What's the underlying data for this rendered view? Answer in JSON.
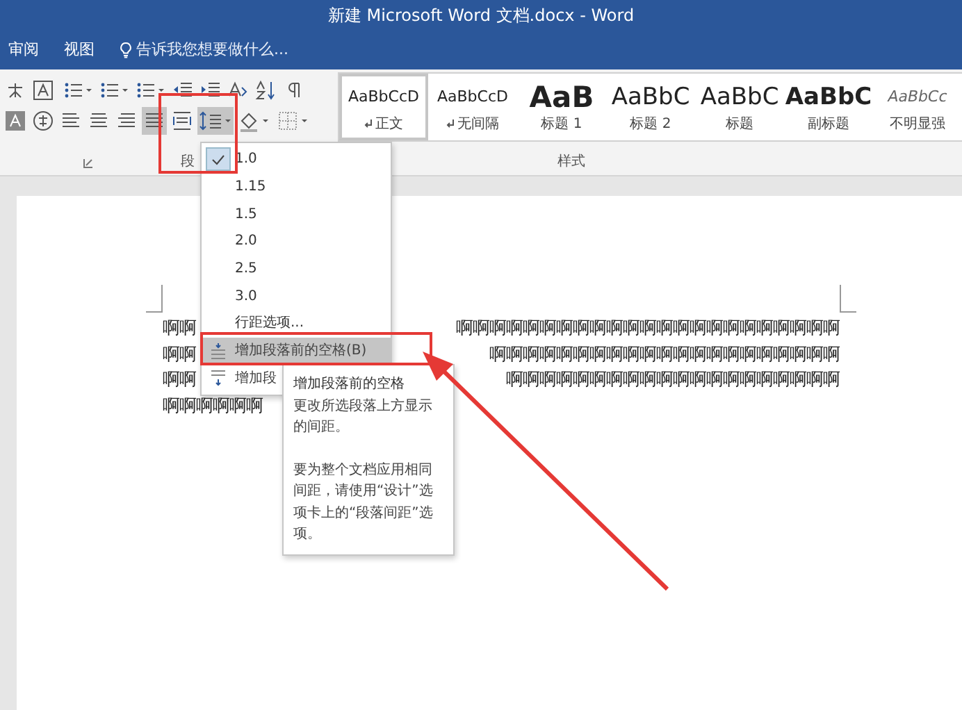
{
  "window": {
    "title": "新建 Microsoft Word 文档.docx - Word"
  },
  "ribbon_tabs": [
    {
      "label": "审阅"
    },
    {
      "label": "视图"
    }
  ],
  "tell_me": {
    "placeholder": "告诉我您想要做什么..."
  },
  "group_labels": [
    "段",
    "样式"
  ],
  "styles": [
    {
      "preview": "AaBbCcD",
      "label": "正文",
      "kind": "normal",
      "para_mark": true,
      "selected": true
    },
    {
      "preview": "AaBbCcD",
      "label": "无间隔",
      "kind": "normal",
      "para_mark": true,
      "selected": false
    },
    {
      "preview": "AaB",
      "label": "标题 1",
      "kind": "heading1",
      "para_mark": false,
      "selected": false
    },
    {
      "preview": "AaBbC",
      "label": "标题 2",
      "kind": "heading2",
      "para_mark": false,
      "selected": false
    },
    {
      "preview": "AaBbC",
      "label": "标题",
      "kind": "title",
      "para_mark": false,
      "selected": false
    },
    {
      "preview": "AaBbC",
      "label": "副标题",
      "kind": "subtitle",
      "para_mark": false,
      "selected": false
    },
    {
      "preview": "AaBbCc",
      "label": "不明显强",
      "kind": "emphasis",
      "para_mark": false,
      "selected": false
    }
  ],
  "document_lines": [
    {
      "left": "啊啊",
      "right": "啊啊啊啊啊啊啊啊啊啊啊啊啊啊啊啊啊啊啊啊啊啊啊"
    },
    {
      "left": "啊啊",
      "right": "啊啊啊啊啊啊啊啊啊啊啊啊啊啊啊啊啊啊啊啊啊"
    },
    {
      "left": "啊啊",
      "right": "啊啊啊啊啊啊啊啊啊啊啊啊啊啊啊啊啊啊啊啊"
    },
    {
      "left": "啊啊啊啊啊啊"
    }
  ],
  "line_spacing_menu": [
    {
      "label": "1.0",
      "kind": "value",
      "checked": true,
      "highlighted": false
    },
    {
      "label": "1.15",
      "kind": "value",
      "checked": false,
      "highlighted": false
    },
    {
      "label": "1.5",
      "kind": "value",
      "checked": false,
      "highlighted": false
    },
    {
      "label": "2.0",
      "kind": "value",
      "checked": false,
      "highlighted": false
    },
    {
      "label": "2.5",
      "kind": "value",
      "checked": false,
      "highlighted": false
    },
    {
      "label": "3.0",
      "kind": "value",
      "checked": false,
      "highlighted": false
    },
    {
      "label": "行距选项...",
      "kind": "value",
      "checked": false,
      "highlighted": false
    },
    {
      "label": "增加段落前的空格(B)",
      "kind": "space_before",
      "checked": false,
      "highlighted": true
    },
    {
      "label": "增加段",
      "kind": "space_after",
      "checked": false,
      "highlighted": false
    }
  ],
  "tooltip": {
    "title": "增加段落前的空格",
    "description": "更改所选段落上方显示的间距。",
    "note": "要为整个文档应用相同间距，请使用“设计”选项卡上的“段落间距”选项。"
  }
}
